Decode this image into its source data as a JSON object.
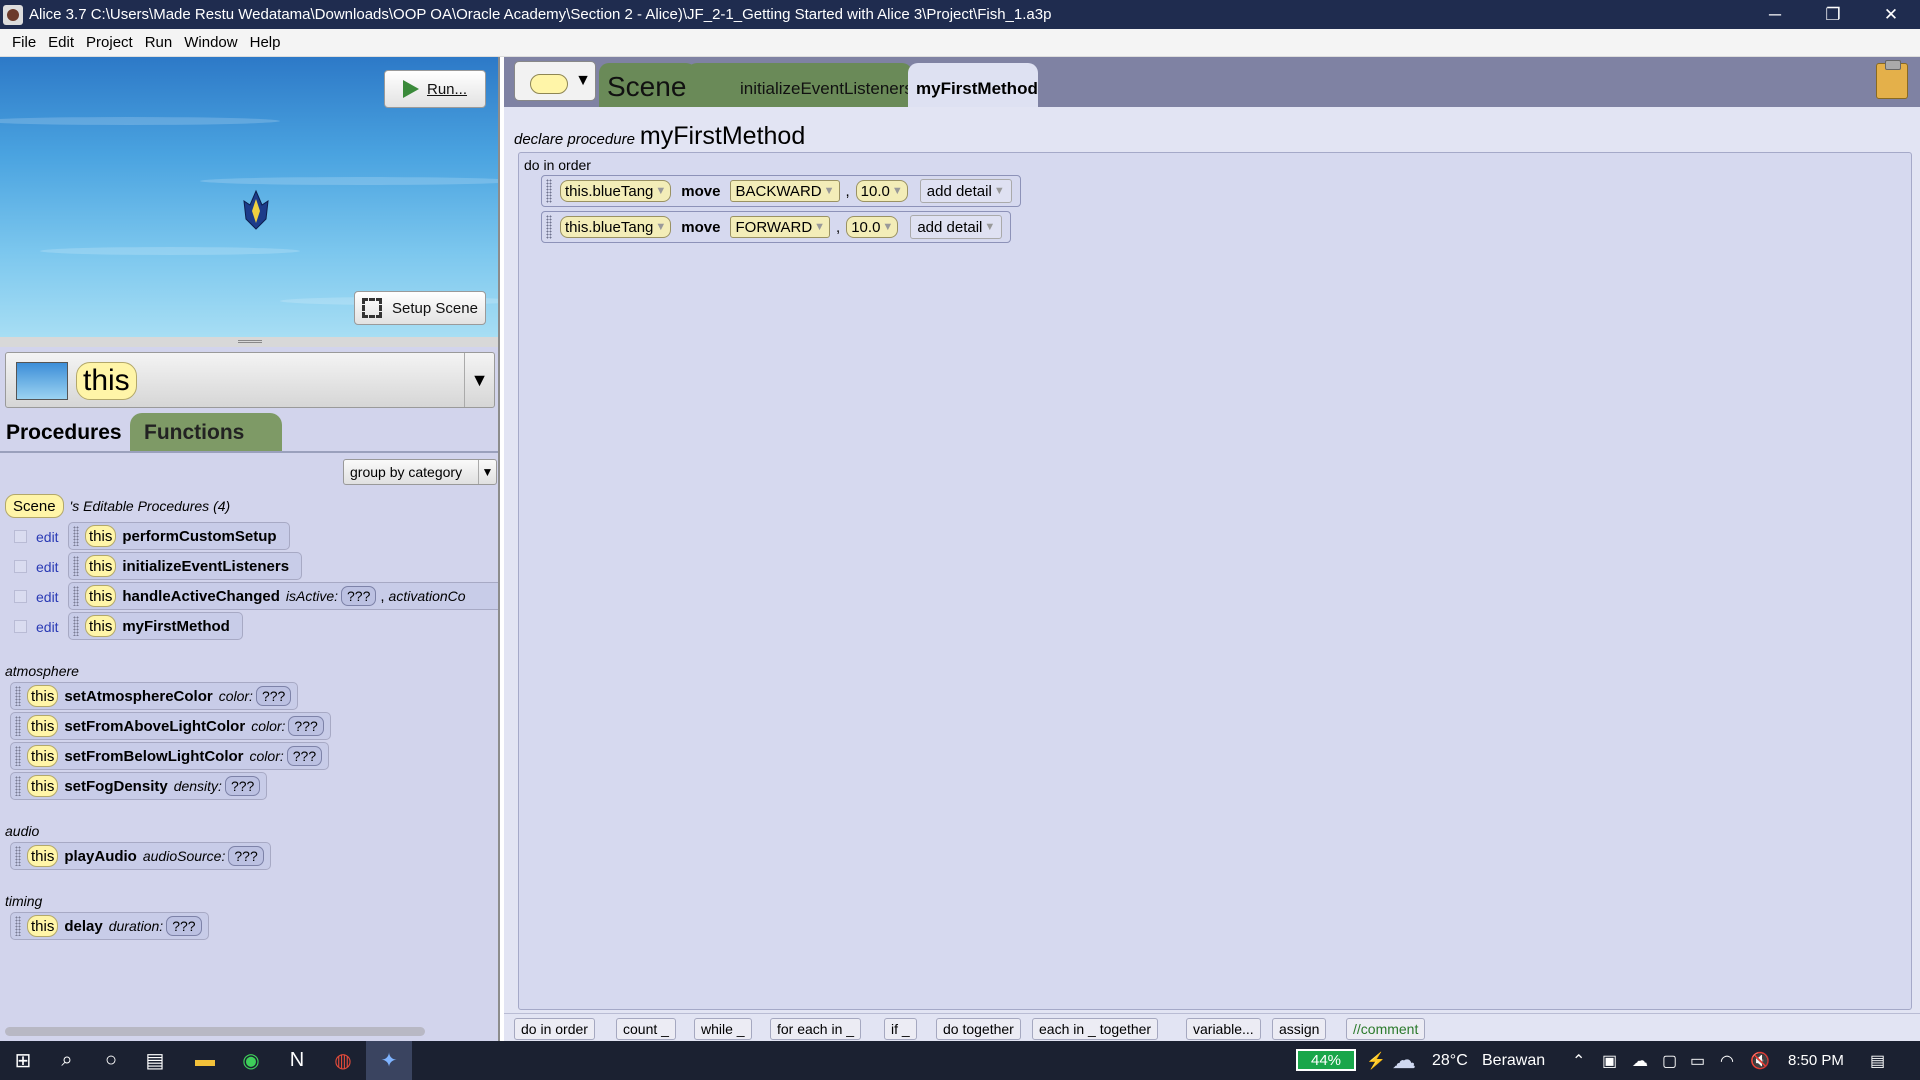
{
  "window": {
    "title": "Alice 3.7 C:\\Users\\Made Restu Wedatama\\Downloads\\OOP OA\\Oracle Academy\\Section 2 - Alice)\\JF_2-1_Getting Started with Alice 3\\Project\\Fish_1.a3p",
    "minimize": "─",
    "restore": "❐",
    "close": "✕"
  },
  "menu": [
    "File",
    "Edit",
    "Project",
    "Run",
    "Window",
    "Help"
  ],
  "scene_view": {
    "run_label": "Run...",
    "setup_label": "Setup Scene"
  },
  "selector": {
    "value": "this"
  },
  "proc_tabs": {
    "procedures": "Procedures",
    "functions": "Functions"
  },
  "group_by": "group by category",
  "editable": {
    "owner": "Scene",
    "label": "'s Editable Procedures (4)",
    "edit": "edit",
    "this": "this",
    "items": [
      {
        "name": "performCustomSetup"
      },
      {
        "name": "initializeEventListeners"
      },
      {
        "name": "handleActiveChanged",
        "param1": "isActive:",
        "param1_val": "???",
        "sep": ",",
        "param2": "activationCo"
      },
      {
        "name": "myFirstMethod"
      }
    ]
  },
  "categories": [
    {
      "title": "atmosphere",
      "items": [
        {
          "name": "setAtmosphereColor",
          "param": "color:",
          "val": "???"
        },
        {
          "name": "setFromAboveLightColor",
          "param": "color:",
          "val": "???"
        },
        {
          "name": "setFromBelowLightColor",
          "param": "color:",
          "val": "???"
        },
        {
          "name": "setFogDensity",
          "param": "density:",
          "val": "???"
        }
      ]
    },
    {
      "title": "audio",
      "items": [
        {
          "name": "playAudio",
          "param": "audioSource:",
          "val": "???"
        }
      ]
    },
    {
      "title": "timing",
      "items": [
        {
          "name": "delay",
          "param": "duration:",
          "val": "???"
        }
      ]
    }
  ],
  "editor_tabs": {
    "scene": "Scene",
    "iel": "initializeEventListeners",
    "mfm": "myFirstMethod"
  },
  "declare": {
    "prefix": "declare procedure",
    "name": "myFirstMethod"
  },
  "do_in_order": "do in order",
  "statements": [
    {
      "object": "this.blueTang",
      "verb": "move",
      "direction": "BACKWARD",
      "sep": ",",
      "amount": "10.0",
      "add": "add detail"
    },
    {
      "object": "this.blueTang",
      "verb": "move",
      "direction": "FORWARD",
      "sep": ",",
      "amount": "10.0",
      "add": "add detail"
    }
  ],
  "controls": [
    "do in order",
    "count _",
    "while _",
    "for each in _",
    "if _",
    "do together",
    "each in _ together",
    "variable...",
    "assign",
    "//comment"
  ],
  "taskbar": {
    "battery": "44%",
    "weather": "28°C",
    "weather_desc": "Berawan",
    "time": "8:50 PM"
  }
}
